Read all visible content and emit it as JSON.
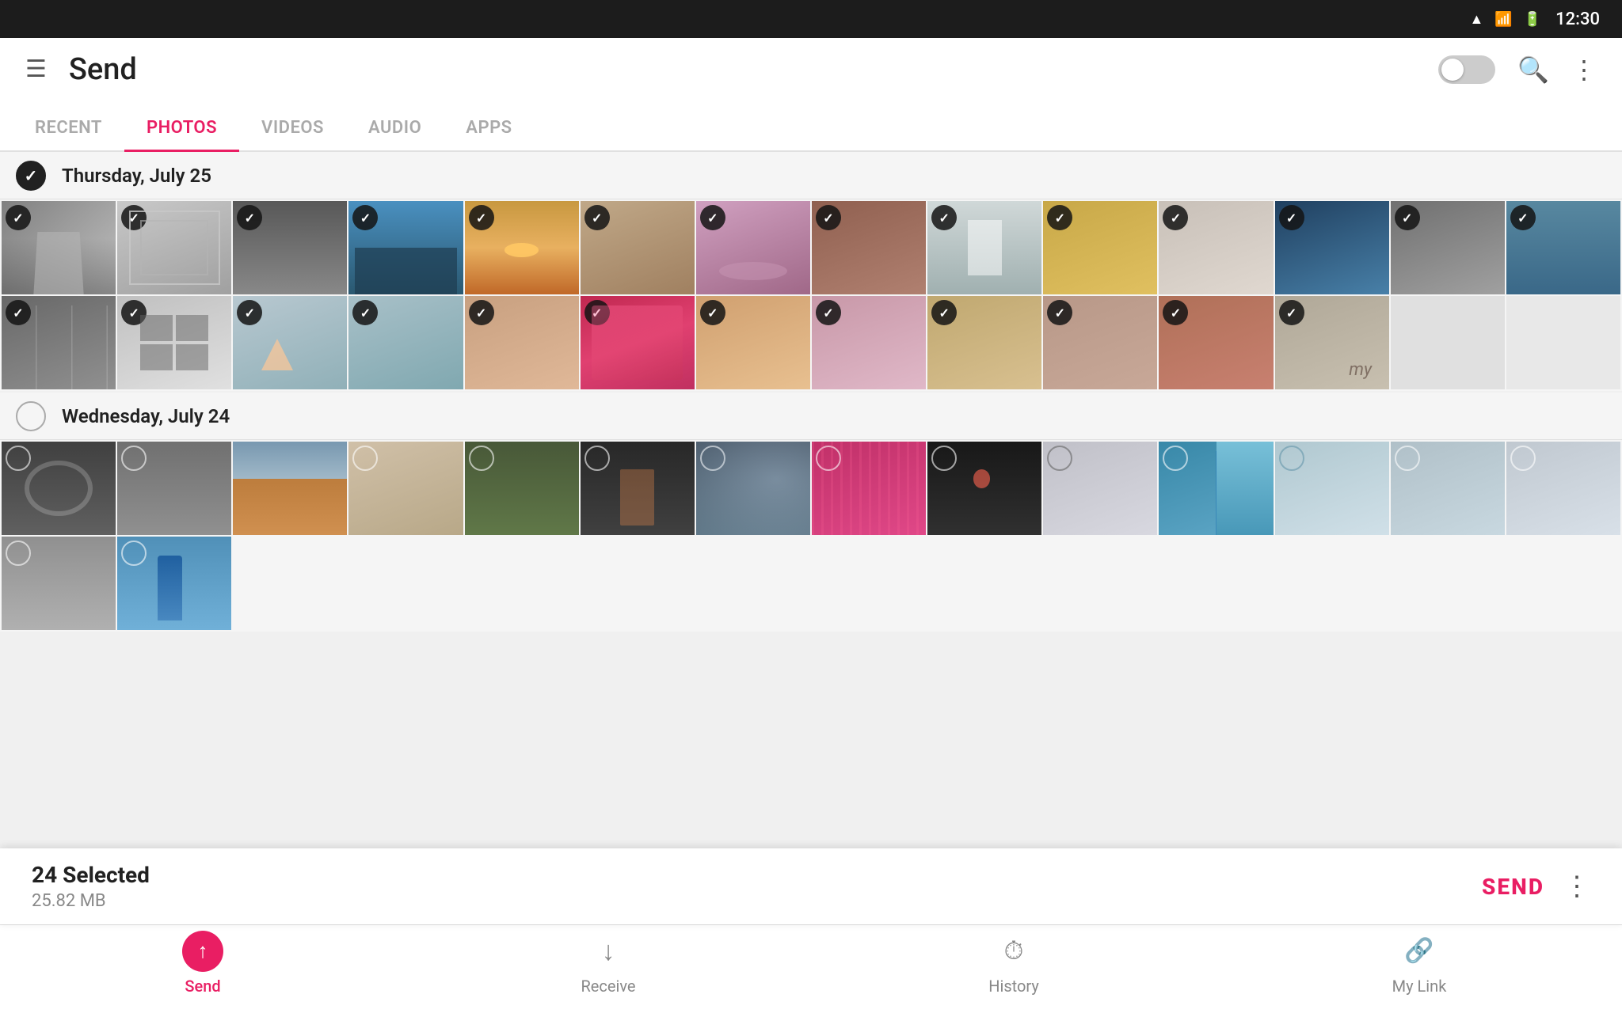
{
  "statusBar": {
    "time": "12:30",
    "icons": [
      "wifi",
      "signal",
      "battery"
    ]
  },
  "appBar": {
    "title": "Send",
    "actions": [
      "toggle",
      "search",
      "more"
    ]
  },
  "tabs": [
    {
      "id": "recent",
      "label": "RECENT",
      "active": false
    },
    {
      "id": "photos",
      "label": "PHOTOS",
      "active": true
    },
    {
      "id": "videos",
      "label": "VIDEOS",
      "active": false
    },
    {
      "id": "audio",
      "label": "AUDIO",
      "active": false
    },
    {
      "id": "apps",
      "label": "APPS",
      "active": false
    }
  ],
  "sections": [
    {
      "date": "Thursday, July 25",
      "selected": true,
      "rows": [
        {
          "photos": [
            {
              "id": "p1",
              "selected": true,
              "color": "#a8a8a8"
            },
            {
              "id": "p2",
              "selected": true,
              "color": "#c0c0c0"
            },
            {
              "id": "p3",
              "selected": true,
              "color": "#686868"
            },
            {
              "id": "p4",
              "selected": true,
              "color": "#4a7a90"
            },
            {
              "id": "p5",
              "selected": true,
              "color": "#c8904a"
            },
            {
              "id": "p6",
              "selected": true,
              "color": "#b89888"
            },
            {
              "id": "p7",
              "selected": true,
              "color": "#b890a8"
            },
            {
              "id": "p8",
              "selected": true,
              "color": "#906850"
            },
            {
              "id": "p9",
              "selected": true,
              "color": "#a8b8b8"
            },
            {
              "id": "p10",
              "selected": true,
              "color": "#c4a050"
            },
            {
              "id": "p11",
              "selected": true,
              "color": "#c0b8b0"
            },
            {
              "id": "p12",
              "selected": true,
              "color": "#305878"
            },
            {
              "id": "p13",
              "selected": true,
              "color": "#808080"
            },
            {
              "id": "p14",
              "selected": true,
              "color": "#b0b0b0"
            }
          ]
        },
        {
          "photos": [
            {
              "id": "p15",
              "selected": true,
              "color": "#808888"
            },
            {
              "id": "p16",
              "selected": true,
              "color": "#b0c8d0"
            },
            {
              "id": "p17",
              "selected": true,
              "color": "#c09880"
            },
            {
              "id": "p18",
              "selected": true,
              "color": "#b83050"
            },
            {
              "id": "p19",
              "selected": true,
              "color": "#d09070"
            },
            {
              "id": "p20",
              "selected": true,
              "color": "#c898a8"
            },
            {
              "id": "p21",
              "selected": true,
              "color": "#c4a878"
            },
            {
              "id": "p22",
              "selected": true,
              "color": "#c0a090"
            },
            {
              "id": "p23",
              "selected": true,
              "color": "#b07050"
            },
            {
              "id": "p24",
              "selected": true,
              "color": "#c0b0a0"
            },
            {
              "id": "p25",
              "selected": true,
              "color": "#d8c0b0"
            },
            {
              "id": "p26",
              "selected": false,
              "color": "#404040",
              "partial": true
            }
          ]
        }
      ]
    },
    {
      "date": "Wednesday, July 24",
      "selected": false,
      "rows": [
        {
          "photos": [
            {
              "id": "q1",
              "selected": false,
              "color": "#383838"
            },
            {
              "id": "q2",
              "selected": false,
              "color": "#686868"
            },
            {
              "id": "q3",
              "selected": false,
              "color": "#b07838"
            },
            {
              "id": "q4",
              "selected": false,
              "color": "#c0b8a8"
            },
            {
              "id": "q5",
              "selected": false,
              "color": "#485838"
            },
            {
              "id": "q6",
              "selected": false,
              "color": "#282828"
            },
            {
              "id": "q7",
              "selected": false,
              "color": "#404858"
            },
            {
              "id": "q8",
              "selected": false,
              "color": "#b83878"
            },
            {
              "id": "q9",
              "selected": false,
              "color": "#181818"
            },
            {
              "id": "q10",
              "selected": false,
              "color": "#b8b8c0"
            },
            {
              "id": "q11",
              "selected": false,
              "color": "#3880a0"
            },
            {
              "id": "q12",
              "selected": false,
              "color": "#b0c0c8"
            },
            {
              "id": "q13",
              "selected": false,
              "color": "#a0b8c8"
            },
            {
              "id": "q14",
              "selected": false,
              "color": "#303030"
            }
          ]
        },
        {
          "photos": [
            {
              "id": "q15",
              "selected": false,
              "color": "#909090"
            },
            {
              "id": "q16",
              "selected": false,
              "color": "#5890b8"
            }
          ]
        }
      ]
    }
  ],
  "selectionBar": {
    "count": "24 Selected",
    "size": "25.82 MB",
    "sendLabel": "SEND"
  },
  "bottomNav": [
    {
      "id": "send",
      "label": "Send",
      "active": true,
      "icon": "↑"
    },
    {
      "id": "receive",
      "label": "Receive",
      "active": false,
      "icon": "↓"
    },
    {
      "id": "history",
      "label": "History",
      "active": false,
      "icon": "⏱"
    },
    {
      "id": "mylink",
      "label": "My Link",
      "active": false,
      "icon": "🔗"
    }
  ]
}
